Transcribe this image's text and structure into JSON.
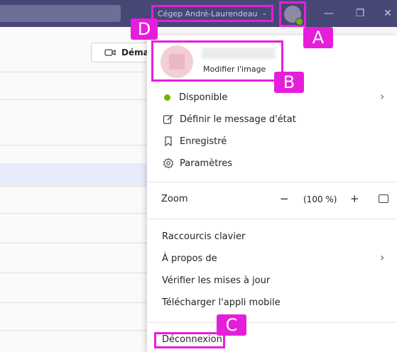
{
  "titlebar": {
    "org_name": "Cégep André-Laurendeau",
    "org_chevron": "⌄",
    "minimize_glyph": "—",
    "maximize_glyph": "❐",
    "close_glyph": "✕"
  },
  "background": {
    "meet_button_label": "Déma",
    "meet_icon": "video-camera-icon"
  },
  "profile": {
    "modify_image_label": "Modifier l'image"
  },
  "menu": {
    "status_label": "Disponible",
    "set_status_message": "Définir le message d'état",
    "saved": "Enregistré",
    "settings": "Paramètres",
    "zoom_label": "Zoom",
    "zoom_minus": "−",
    "zoom_value": "(100 %)",
    "zoom_plus": "+",
    "shortcuts": "Raccourcis clavier",
    "about": "À propos de",
    "check_updates": "Vérifier les mises à jour",
    "download_mobile": "Télécharger l'appli mobile",
    "logout": "Déconnexion",
    "chevron": "›"
  },
  "callouts": {
    "a": "A",
    "b": "B",
    "c": "C",
    "d": "D"
  },
  "colors": {
    "titlebar": "#464775",
    "callout": "#e61edc",
    "status_available": "#6bb700"
  }
}
